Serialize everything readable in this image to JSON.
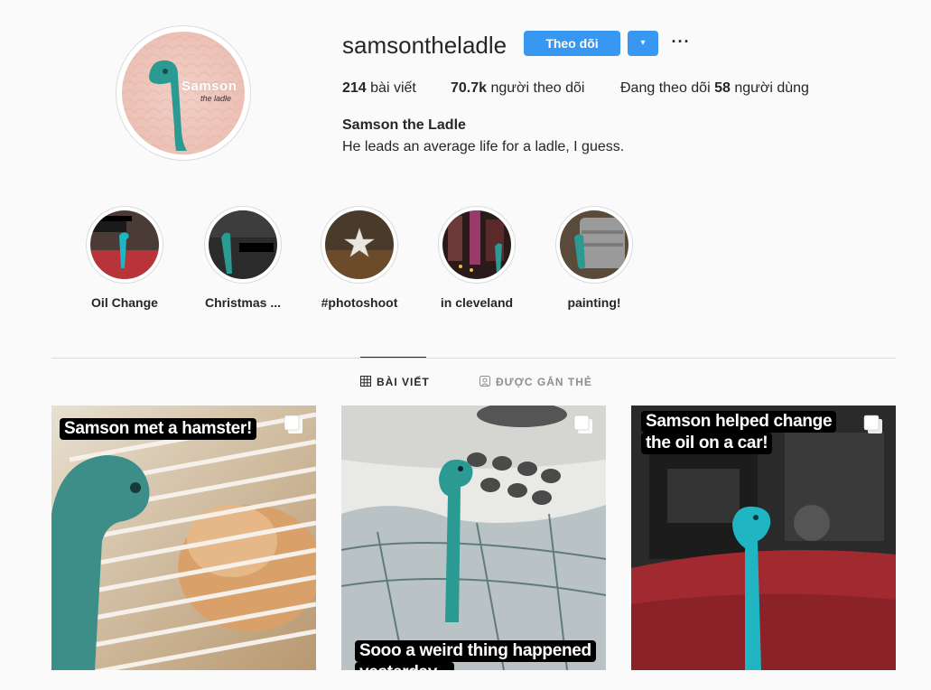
{
  "profile": {
    "username": "samsontheladle",
    "follow_label": "Theo dõi",
    "dropdown_label": "▾",
    "more_label": "···",
    "avatar_title": "Samson",
    "avatar_subtitle": "the ladle",
    "posts_count": "214",
    "posts_label": "bài viết",
    "followers_count": "70.7k",
    "followers_label": "người theo dõi",
    "following_prefix": "Đang theo dõi",
    "following_count": "58",
    "following_suffix": "người dùng",
    "full_name": "Samson the Ladle",
    "bio": "He leads an average life for a ladle, I guess."
  },
  "highlights": [
    {
      "label": "Oil Change",
      "icon": "highlight-oil-change"
    },
    {
      "label": "Christmas ...",
      "icon": "highlight-christmas"
    },
    {
      "label": "#photoshoot",
      "icon": "highlight-photoshoot"
    },
    {
      "label": "in cleveland",
      "icon": "highlight-cleveland"
    },
    {
      "label": "painting!",
      "icon": "highlight-painting"
    }
  ],
  "tabs": [
    {
      "label": "BÀI VIẾT",
      "icon": "grid-icon",
      "active": true
    },
    {
      "label": "ĐƯỢC GẮN THẺ",
      "icon": "tagged-icon",
      "active": false
    }
  ],
  "posts": [
    {
      "caption": "Samson met a hamster!",
      "multi": true
    },
    {
      "caption": "Sooo a weird thing happened",
      "caption2": "yesterday...",
      "multi": true
    },
    {
      "caption": "Samson helped change",
      "caption2": "the oil on a car!",
      "multi": true
    }
  ],
  "colors": {
    "accent": "#3897f0",
    "ladle": "#2a9a93",
    "ladle_bright": "#1fb5c3",
    "text": "#262626",
    "border": "#dbdbdb"
  }
}
